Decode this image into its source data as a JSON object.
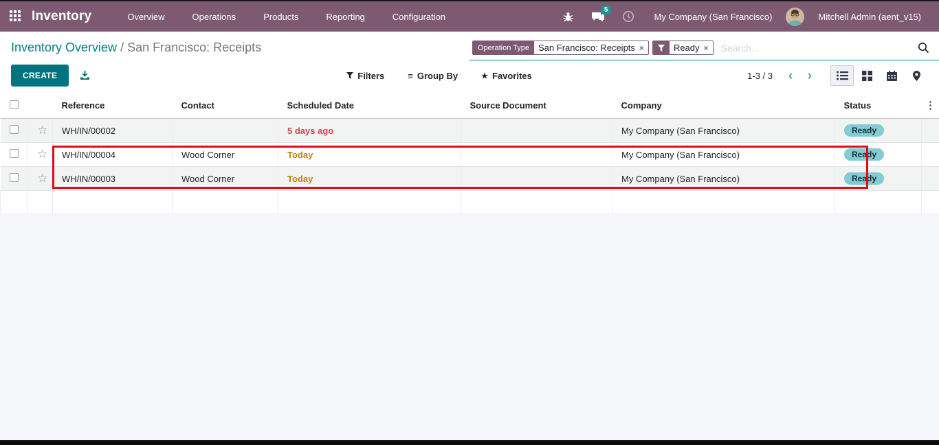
{
  "nav": {
    "app_name": "Inventory",
    "menu": [
      {
        "label": "Overview"
      },
      {
        "label": "Operations"
      },
      {
        "label": "Products"
      },
      {
        "label": "Reporting"
      },
      {
        "label": "Configuration"
      }
    ],
    "messages_badge": "5",
    "company": "My Company (San Francisco)",
    "user": "Mitchell Admin (aent_v15)"
  },
  "breadcrumb": {
    "parent": "Inventory Overview",
    "separator": " / ",
    "current": "San Francisco: Receipts"
  },
  "search": {
    "placeholder": "Search...",
    "facets": [
      {
        "label": "Operation Type",
        "value": "San Francisco: Receipts",
        "remove": "×"
      },
      {
        "label": "filter-icon",
        "value": "Ready",
        "remove": "×"
      }
    ]
  },
  "toolbar": {
    "create_label": "CREATE",
    "filters_label": "Filters",
    "groupby_label": "Group By",
    "favorites_label": "Favorites",
    "favorites_star": "★",
    "groupby_glyph": "≡",
    "pager_value": "1-3 / 3",
    "prev_glyph": "‹",
    "next_glyph": "›",
    "options_glyph": "⋮"
  },
  "table": {
    "headers": {
      "reference": "Reference",
      "contact": "Contact",
      "scheduled_date": "Scheduled Date",
      "source_document": "Source Document",
      "company": "Company",
      "status": "Status"
    },
    "star_glyph": "☆",
    "rows": [
      {
        "reference": "WH/IN/00002",
        "contact": "",
        "scheduled": "5 days ago",
        "source": "",
        "company": "My Company (San Francisco)",
        "status": "Ready"
      },
      {
        "reference": "WH/IN/00004",
        "contact": "Wood Corner",
        "scheduled": "Today",
        "source": "",
        "company": "My Company (San Francisco)",
        "status": "Ready"
      },
      {
        "reference": "WH/IN/00003",
        "contact": "Wood Corner",
        "scheduled": "Today",
        "source": "",
        "company": "My Company (San Francisco)",
        "status": "Ready"
      }
    ]
  },
  "colors": {
    "nav_purple": "#7d5a72",
    "accent_teal": "#017e84",
    "create_button": "#00747e",
    "badge_teal": "#109a93",
    "status_badge_bg": "#82ccd6",
    "danger_text": "#dc4150",
    "warning_text": "#b8860b",
    "annotation_red": "#e30b13"
  }
}
